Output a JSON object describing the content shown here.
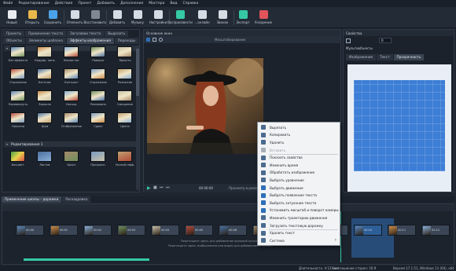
{
  "menu": [
    "Файл",
    "Редактирование",
    "Действия",
    "Проект",
    "Добавить",
    "Дополнения",
    "Мастера",
    "Вид",
    "Справка"
  ],
  "toolbar": {
    "buttons": [
      {
        "label": "Новый",
        "icon": "new-project-icon",
        "color": "#e9edf2"
      },
      {
        "label": "Открыть",
        "icon": "open-folder-icon",
        "color": "#e8b84a"
      },
      {
        "label": "Сохранить",
        "icon": "save-icon",
        "color": "#4aa3e8"
      },
      {
        "label": "Отменить",
        "icon": "undo-icon",
        "color": "#d6dce4"
      },
      {
        "label": "Восстановить",
        "icon": "redo-icon",
        "color": "#7f8893"
      },
      {
        "label": "Добавить",
        "icon": "add-icon",
        "color": "#d6dce4"
      },
      {
        "label": "Музыку",
        "icon": "music-icon",
        "color": "#d6dce4"
      },
      {
        "label": "Настройки",
        "icon": "settings-icon",
        "color": "#d6dce4"
      },
      {
        "label": "Воспроизвести",
        "icon": "play-icon",
        "color": "#35c9a6"
      },
      {
        "label": "…онлайн",
        "icon": "upload-icon",
        "color": "#d6dce4"
      },
      {
        "label": "Звонок",
        "icon": "phone-icon",
        "color": "#d6dce4"
      },
      {
        "label": "Экспорт",
        "icon": "export-icon",
        "color": "#35c9a6"
      },
      {
        "label": "Ускорение",
        "icon": "speed-icon",
        "color": "#e0545a"
      }
    ]
  },
  "left_panel": {
    "tabs_top": [
      "Проекты",
      "Применение текста",
      "Заголовки текста",
      "Выделить"
    ],
    "tabs": [
      "Объекты",
      "Элементы шаблона",
      "Эффекты изображения",
      "Переходы"
    ],
    "group1": "Общие",
    "group2": "Редактирование 1",
    "effects": [
      "Без эффекта",
      "Кадрир. линк",
      "Наклон вл.",
      "Поворот",
      "Яркость",
      "Отражение",
      "Негатив.",
      "Контраст",
      "Отражение",
      "Размытие",
      "Перевернуть",
      "Зеркало",
      "Насыщ.",
      "Размывать",
      "Смещение",
      "Пиксели",
      "Шум",
      "Отображение",
      "Сдвиг",
      "Цвета"
    ],
    "effects2": [
      "Бесцвет.",
      "Ластик",
      "Кросс",
      "Прозрачн.",
      "Ночной эфф."
    ]
  },
  "preview": {
    "title": "Основное окно",
    "zoom": "Масштабирование",
    "timecode": "00:00:00",
    "fit_label": "Просмотр в реальном"
  },
  "properties": {
    "title": "Свойства",
    "object": "Изображение",
    "tabs": [
      "Изображение",
      "Текст",
      "Прозрачность"
    ],
    "value": "0",
    "unit": "Мультиобъекты"
  },
  "timeline": {
    "tabs": [
      "Применение шкалы – дорожки",
      "Раскадровка"
    ],
    "clips": [
      "00:00",
      "00:01",
      "00:02",
      "00:03",
      "00:04",
      "00:05",
      "00:06",
      "00:07",
      "00:08",
      "00:09",
      "00:10",
      "00:11",
      "00:12"
    ],
    "hint_line1": "Перетащите здесь для добавления фоновой музыки",
    "hint_line2": "Перетащите здесь изображения или видео для добавления в проект"
  },
  "context_menu": {
    "items": [
      {
        "label": "Вырезать",
        "icon": "cut-icon",
        "color": "#4a6b8f",
        "disabled": false
      },
      {
        "label": "Копировать",
        "icon": "copy-icon",
        "color": "#4a6b8f",
        "disabled": false
      },
      {
        "label": "Удалить",
        "icon": "delete-icon",
        "color": "#4a6b8f",
        "disabled": false
      },
      {
        "label": "Вставить",
        "icon": "paste-icon",
        "color": "#a7aeb7",
        "disabled": true
      },
      {
        "label": "Показать свойства",
        "icon": "properties-icon",
        "color": "#4a6b8f",
        "disabled": false
      },
      {
        "label": "Изменить время",
        "icon": "time-icon",
        "color": "#4a6b8f",
        "disabled": false
      },
      {
        "label": "Обработать изображение",
        "icon": "image-edit-icon",
        "color": "#4a6b8f",
        "disabled": false
      },
      {
        "label": "Выбрать уровнение",
        "icon": "levels-icon",
        "color": "#4a6b8f",
        "disabled": false
      },
      {
        "label": "Выбрать движение",
        "icon": "motion-icon",
        "color": "#2e6fb8",
        "disabled": false
      },
      {
        "label": "Выбрать появление текста",
        "icon": "text-in-icon",
        "color": "#2e6fb8",
        "disabled": false
      },
      {
        "label": "Выбрать затухание текста",
        "icon": "text-out-icon",
        "color": "#2e6fb8",
        "disabled": false
      },
      {
        "label": "Установить масштаб и поворот камеры",
        "icon": "camera-icon",
        "color": "#2e6fb8",
        "disabled": false
      },
      {
        "label": "Изменить траекторию движения",
        "icon": "path-icon",
        "color": "#4a6b8f",
        "disabled": false
      },
      {
        "label": "Загрузить текстовую дорожку",
        "icon": "load-track-icon",
        "color": "#4a6b8f",
        "disabled": false
      },
      {
        "label": "Удалить текст",
        "icon": "delete-text-icon",
        "color": "#4a6b8f",
        "disabled": false
      },
      {
        "label": "Система",
        "icon": "system-icon",
        "color": "#4a6b8f",
        "disabled": false
      }
    ]
  },
  "status": {
    "duration": "Длительность: 4:12 мин",
    "ratio": "Соотношение сторон: 16:9",
    "version": "Версия 17.1.51, Windows 11 (64), x64"
  },
  "colors": {
    "accent": "#35c9a6",
    "brand": "#2e6fb8",
    "panel": "#1b222c"
  }
}
